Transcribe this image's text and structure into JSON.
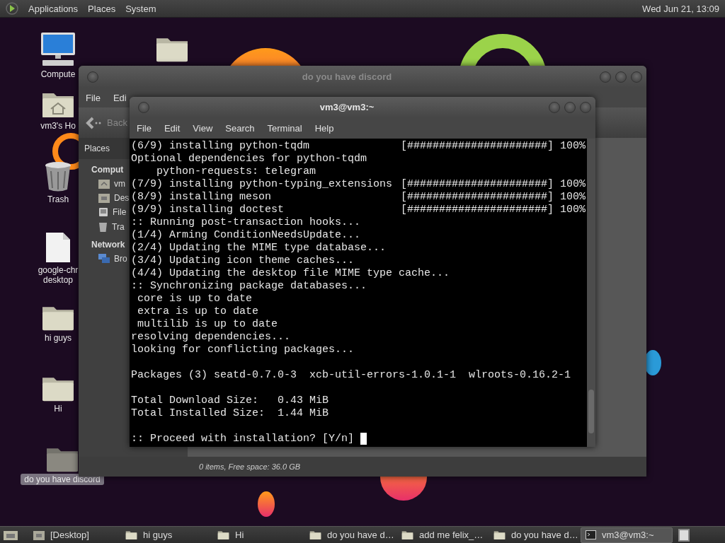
{
  "top_panel": {
    "menus": [
      "Applications",
      "Places",
      "System"
    ],
    "clock": "Wed Jun 21, 13:09"
  },
  "desktop_icons": [
    {
      "kind": "computer",
      "lines": [
        "Compute"
      ],
      "selected": false
    },
    {
      "kind": "home",
      "lines": [
        "vm3's Ho"
      ],
      "selected": false
    },
    {
      "kind": "trash",
      "lines": [
        "Trash"
      ],
      "selected": false
    },
    {
      "kind": "file",
      "lines": [
        "google-chr",
        "desktop"
      ],
      "selected": false
    },
    {
      "kind": "folder",
      "lines": [
        "hi guys"
      ],
      "selected": false
    },
    {
      "kind": "folder",
      "lines": [
        "Hi"
      ],
      "selected": false
    },
    {
      "kind": "folder",
      "lines": [
        "do you have discord"
      ],
      "selected": true
    },
    {
      "kind": "folder",
      "selected": false
    }
  ],
  "file_manager": {
    "title": "do you have discord",
    "menus": [
      "File",
      "Edi"
    ],
    "back": "Back",
    "sidebar": {
      "header": "Places",
      "sections": [
        {
          "heading": "Comput",
          "items": [
            {
              "kind": "home",
              "label": "vm"
            },
            {
              "kind": "desktop",
              "label": "Des"
            },
            {
              "kind": "drive",
              "label": "File"
            },
            {
              "kind": "trash",
              "label": "Tra"
            }
          ]
        },
        {
          "heading": "Network",
          "items": [
            {
              "kind": "network",
              "label": "Bro"
            }
          ]
        }
      ]
    },
    "status": "0 items, Free space: 36.0 GB"
  },
  "terminal": {
    "title": "vm3@vm3:~",
    "menus": [
      "File",
      "Edit",
      "View",
      "Search",
      "Terminal",
      "Help"
    ],
    "lines": [
      {
        "kind": "text",
        "text": "(6/9) installing python-tqdm",
        "progress": "[######################] 100%"
      },
      {
        "kind": "text",
        "text": "Optional dependencies for python-tqdm"
      },
      {
        "kind": "text",
        "text": "    python-requests: telegram"
      },
      {
        "kind": "text",
        "text": "(7/9) installing python-typing_extensions",
        "progress": "[######################] 100%"
      },
      {
        "kind": "text",
        "text": "(8/9) installing meson",
        "progress": "[######################] 100%"
      },
      {
        "kind": "text",
        "text": "(9/9) installing doctest",
        "progress": "[######################] 100%"
      },
      {
        "kind": "text",
        "text": ":: Running post-transaction hooks..."
      },
      {
        "kind": "text",
        "text": "(1/4) Arming ConditionNeedsUpdate..."
      },
      {
        "kind": "text",
        "text": "(2/4) Updating the MIME type database..."
      },
      {
        "kind": "text",
        "text": "(3/4) Updating icon theme caches..."
      },
      {
        "kind": "text",
        "text": "(4/4) Updating the desktop file MIME type cache..."
      },
      {
        "kind": "text",
        "text": ":: Synchronizing package databases..."
      },
      {
        "kind": "text",
        "text": " core is up to date"
      },
      {
        "kind": "text",
        "text": " extra is up to date"
      },
      {
        "kind": "text",
        "text": " multilib is up to date"
      },
      {
        "kind": "text",
        "text": "resolving dependencies..."
      },
      {
        "kind": "text",
        "text": "looking for conflicting packages..."
      },
      {
        "kind": "blank"
      },
      {
        "kind": "text",
        "text": "Packages (3) seatd-0.7.0-3  xcb-util-errors-1.0.1-1  wlroots-0.16.2-1"
      },
      {
        "kind": "blank"
      },
      {
        "kind": "text",
        "text": "Total Download Size:   0.43 MiB"
      },
      {
        "kind": "text",
        "text": "Total Installed Size:  1.44 MiB"
      },
      {
        "kind": "blank"
      },
      {
        "kind": "prompt",
        "text": ":: Proceed with installation? [Y/n]"
      }
    ]
  },
  "taskbar": {
    "items": [
      {
        "kind": "desktop",
        "label": "[Desktop]",
        "selected": false
      },
      {
        "kind": "folder",
        "label": "hi guys",
        "selected": false
      },
      {
        "kind": "folder",
        "label": "Hi",
        "selected": false
      },
      {
        "kind": "folder",
        "label": "do you have d…",
        "selected": false
      },
      {
        "kind": "folder",
        "label": "add me felix_…",
        "selected": false
      },
      {
        "kind": "folder",
        "label": "do you have d…",
        "selected": false
      },
      {
        "kind": "terminal",
        "label": "vm3@vm3:~",
        "selected": true
      }
    ]
  }
}
